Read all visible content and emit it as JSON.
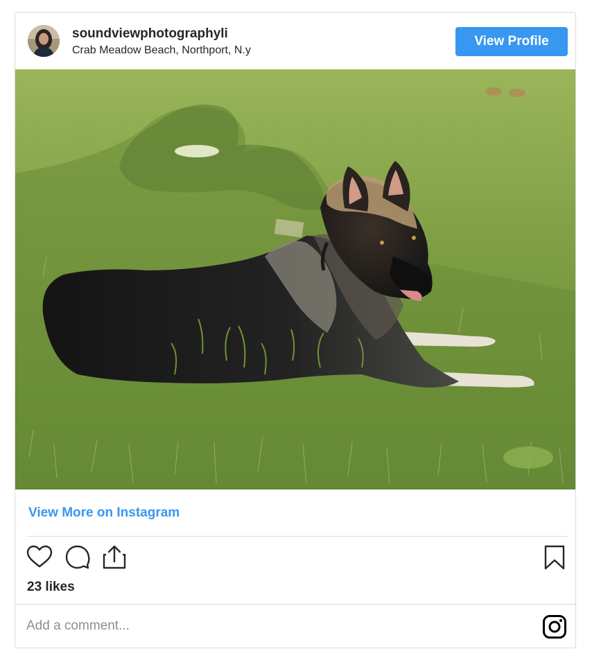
{
  "header": {
    "username": "soundviewphotographyli",
    "location": "Crab Meadow Beach, Northport, N.y",
    "view_profile_label": "View Profile"
  },
  "post": {
    "image_icon": "dog-lying-on-grass-photo",
    "view_more_label": "View More on Instagram",
    "likes_text": "23 likes"
  },
  "actions": {
    "icons": [
      "heart-icon",
      "comment-icon",
      "share-icon",
      "bookmark-icon"
    ]
  },
  "comment": {
    "placeholder": "Add a comment...",
    "logo_icon": "instagram-icon"
  },
  "colors": {
    "accent": "#3897f0",
    "text": "#262626",
    "muted": "#8e8e8e",
    "border": "#dbdbdb"
  }
}
